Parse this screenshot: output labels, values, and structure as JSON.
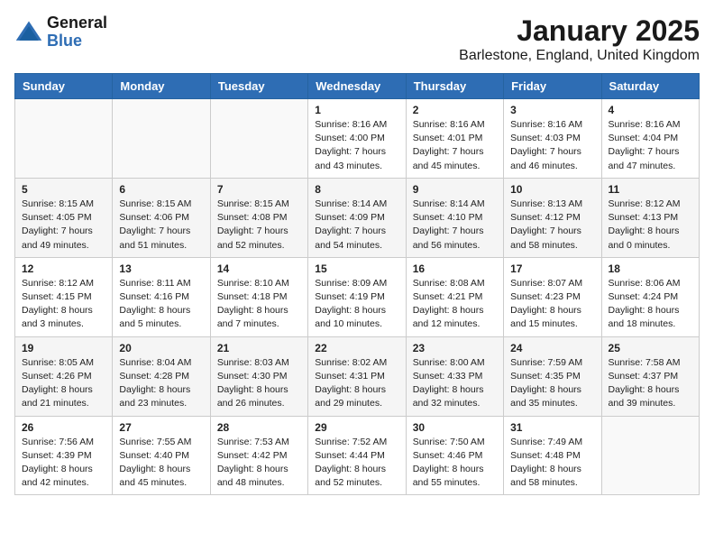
{
  "header": {
    "logo_general": "General",
    "logo_blue": "Blue",
    "month_title": "January 2025",
    "location": "Barlestone, England, United Kingdom"
  },
  "days_of_week": [
    "Sunday",
    "Monday",
    "Tuesday",
    "Wednesday",
    "Thursday",
    "Friday",
    "Saturday"
  ],
  "weeks": [
    [
      {
        "day": "",
        "info": ""
      },
      {
        "day": "",
        "info": ""
      },
      {
        "day": "",
        "info": ""
      },
      {
        "day": "1",
        "info": "Sunrise: 8:16 AM\nSunset: 4:00 PM\nDaylight: 7 hours\nand 43 minutes."
      },
      {
        "day": "2",
        "info": "Sunrise: 8:16 AM\nSunset: 4:01 PM\nDaylight: 7 hours\nand 45 minutes."
      },
      {
        "day": "3",
        "info": "Sunrise: 8:16 AM\nSunset: 4:03 PM\nDaylight: 7 hours\nand 46 minutes."
      },
      {
        "day": "4",
        "info": "Sunrise: 8:16 AM\nSunset: 4:04 PM\nDaylight: 7 hours\nand 47 minutes."
      }
    ],
    [
      {
        "day": "5",
        "info": "Sunrise: 8:15 AM\nSunset: 4:05 PM\nDaylight: 7 hours\nand 49 minutes."
      },
      {
        "day": "6",
        "info": "Sunrise: 8:15 AM\nSunset: 4:06 PM\nDaylight: 7 hours\nand 51 minutes."
      },
      {
        "day": "7",
        "info": "Sunrise: 8:15 AM\nSunset: 4:08 PM\nDaylight: 7 hours\nand 52 minutes."
      },
      {
        "day": "8",
        "info": "Sunrise: 8:14 AM\nSunset: 4:09 PM\nDaylight: 7 hours\nand 54 minutes."
      },
      {
        "day": "9",
        "info": "Sunrise: 8:14 AM\nSunset: 4:10 PM\nDaylight: 7 hours\nand 56 minutes."
      },
      {
        "day": "10",
        "info": "Sunrise: 8:13 AM\nSunset: 4:12 PM\nDaylight: 7 hours\nand 58 minutes."
      },
      {
        "day": "11",
        "info": "Sunrise: 8:12 AM\nSunset: 4:13 PM\nDaylight: 8 hours\nand 0 minutes."
      }
    ],
    [
      {
        "day": "12",
        "info": "Sunrise: 8:12 AM\nSunset: 4:15 PM\nDaylight: 8 hours\nand 3 minutes."
      },
      {
        "day": "13",
        "info": "Sunrise: 8:11 AM\nSunset: 4:16 PM\nDaylight: 8 hours\nand 5 minutes."
      },
      {
        "day": "14",
        "info": "Sunrise: 8:10 AM\nSunset: 4:18 PM\nDaylight: 8 hours\nand 7 minutes."
      },
      {
        "day": "15",
        "info": "Sunrise: 8:09 AM\nSunset: 4:19 PM\nDaylight: 8 hours\nand 10 minutes."
      },
      {
        "day": "16",
        "info": "Sunrise: 8:08 AM\nSunset: 4:21 PM\nDaylight: 8 hours\nand 12 minutes."
      },
      {
        "day": "17",
        "info": "Sunrise: 8:07 AM\nSunset: 4:23 PM\nDaylight: 8 hours\nand 15 minutes."
      },
      {
        "day": "18",
        "info": "Sunrise: 8:06 AM\nSunset: 4:24 PM\nDaylight: 8 hours\nand 18 minutes."
      }
    ],
    [
      {
        "day": "19",
        "info": "Sunrise: 8:05 AM\nSunset: 4:26 PM\nDaylight: 8 hours\nand 21 minutes."
      },
      {
        "day": "20",
        "info": "Sunrise: 8:04 AM\nSunset: 4:28 PM\nDaylight: 8 hours\nand 23 minutes."
      },
      {
        "day": "21",
        "info": "Sunrise: 8:03 AM\nSunset: 4:30 PM\nDaylight: 8 hours\nand 26 minutes."
      },
      {
        "day": "22",
        "info": "Sunrise: 8:02 AM\nSunset: 4:31 PM\nDaylight: 8 hours\nand 29 minutes."
      },
      {
        "day": "23",
        "info": "Sunrise: 8:00 AM\nSunset: 4:33 PM\nDaylight: 8 hours\nand 32 minutes."
      },
      {
        "day": "24",
        "info": "Sunrise: 7:59 AM\nSunset: 4:35 PM\nDaylight: 8 hours\nand 35 minutes."
      },
      {
        "day": "25",
        "info": "Sunrise: 7:58 AM\nSunset: 4:37 PM\nDaylight: 8 hours\nand 39 minutes."
      }
    ],
    [
      {
        "day": "26",
        "info": "Sunrise: 7:56 AM\nSunset: 4:39 PM\nDaylight: 8 hours\nand 42 minutes."
      },
      {
        "day": "27",
        "info": "Sunrise: 7:55 AM\nSunset: 4:40 PM\nDaylight: 8 hours\nand 45 minutes."
      },
      {
        "day": "28",
        "info": "Sunrise: 7:53 AM\nSunset: 4:42 PM\nDaylight: 8 hours\nand 48 minutes."
      },
      {
        "day": "29",
        "info": "Sunrise: 7:52 AM\nSunset: 4:44 PM\nDaylight: 8 hours\nand 52 minutes."
      },
      {
        "day": "30",
        "info": "Sunrise: 7:50 AM\nSunset: 4:46 PM\nDaylight: 8 hours\nand 55 minutes."
      },
      {
        "day": "31",
        "info": "Sunrise: 7:49 AM\nSunset: 4:48 PM\nDaylight: 8 hours\nand 58 minutes."
      },
      {
        "day": "",
        "info": ""
      }
    ]
  ]
}
